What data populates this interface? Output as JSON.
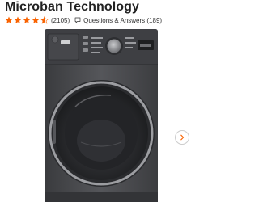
{
  "product": {
    "title": "Microban Technology",
    "rating": 4.5,
    "rating_max": 5,
    "review_count": "(2105)",
    "qa_label": "Questions & Answers (189)"
  },
  "colors": {
    "star": "#f96302",
    "washer_body": "#4a4b4f",
    "text": "#222222"
  },
  "icons": {
    "star": "star-icon",
    "qa": "speech-bubble-icon",
    "next": "chevron-right-icon"
  }
}
